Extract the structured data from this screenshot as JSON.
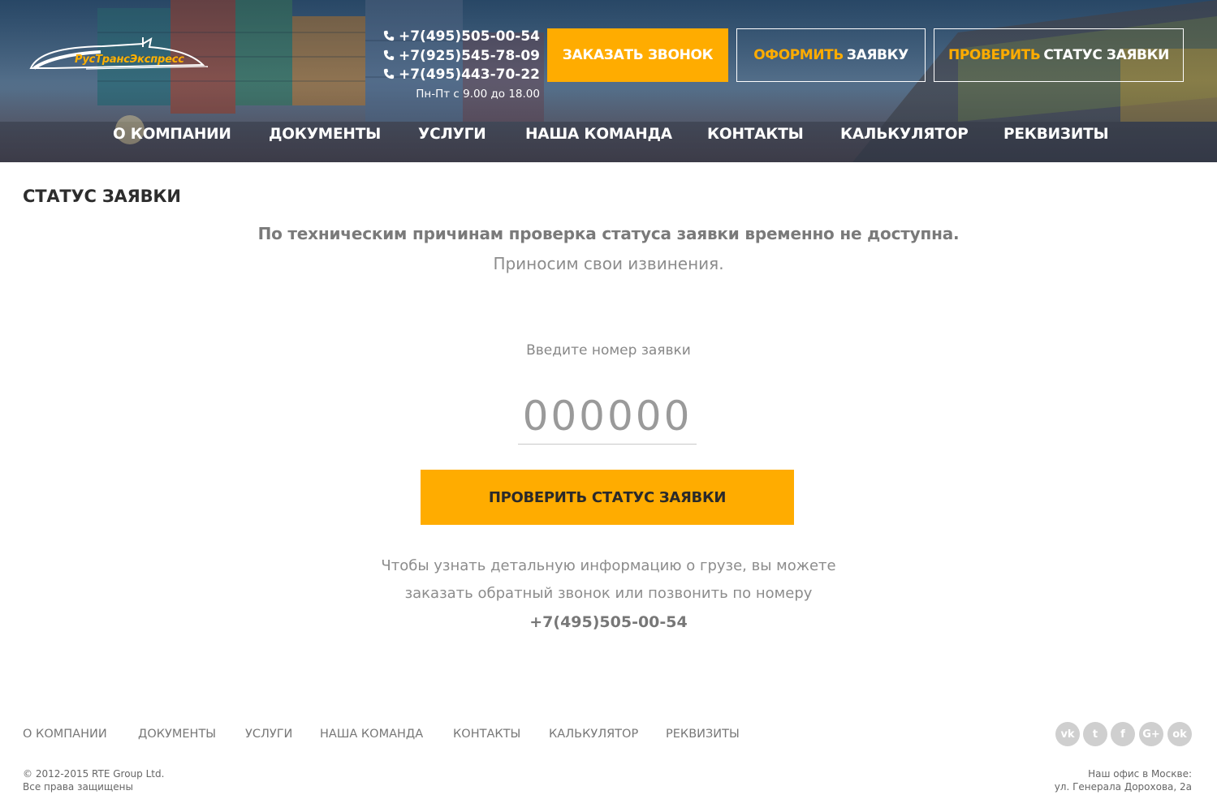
{
  "header": {
    "logo_text": "РусТрансЭкспресс",
    "phones": [
      "+7(495)505-00-54",
      "+7(925)545-78-09",
      "+7(495)443-70-22"
    ],
    "hours": "Пн-Пт с 9.00 до 18.00",
    "call_button": "ЗАКАЗАТЬ ЗВОНОК",
    "order_button": {
      "accent": "ОФОРМИТЬ",
      "rest": "ЗАЯВКУ"
    },
    "status_button": {
      "accent": "ПРОВЕРИТЬ",
      "rest": "СТАТУС ЗАЯВКИ"
    },
    "accent_color": "#ffac00"
  },
  "nav": [
    "О КОМПАНИИ",
    "ДОКУМЕНТЫ",
    "УСЛУГИ",
    "НАША КОМАНДА",
    "КОНТАКТЫ",
    "КАЛЬКУЛЯТОР",
    "РЕКВИЗИТЫ"
  ],
  "main": {
    "title": "СТАТУС ЗАЯВКИ",
    "notice": "По техническим причинам проверка статуса заявки временно не доступна.",
    "apology": "Приносим свои извинения.",
    "field_label": "Введите номер заявки",
    "input_placeholder": "000000",
    "check_button": "ПРОВЕРИТЬ СТАТУС ЗАЯВКИ",
    "info_line1": "Чтобы узнать детальную информацию о грузе, вы можете",
    "info_line2": "заказать обратный звонок или позвонить по номеру",
    "info_phone": "+7(495)505-00-54"
  },
  "footer": {
    "nav": [
      "О КОМПАНИИ",
      "ДОКУМЕНТЫ",
      "УСЛУГИ",
      "НАША КОМАНДА",
      "КОНТАКТЫ",
      "КАЛЬКУЛЯТОР",
      "РЕКВИЗИТЫ"
    ],
    "socials": [
      {
        "name": "vk-icon",
        "glyph": "vk"
      },
      {
        "name": "twitter-icon",
        "glyph": "t"
      },
      {
        "name": "facebook-icon",
        "glyph": "f"
      },
      {
        "name": "google-plus-icon",
        "glyph": "G+"
      },
      {
        "name": "odnoklassniki-icon",
        "glyph": "ok"
      }
    ],
    "copyright": "© 2012-2015 RTE Group Ltd.",
    "rights": "Все права защищены",
    "office_label": "Наш офис в Москве:",
    "office_address": "ул. Генерала Дорохова, 2а"
  }
}
